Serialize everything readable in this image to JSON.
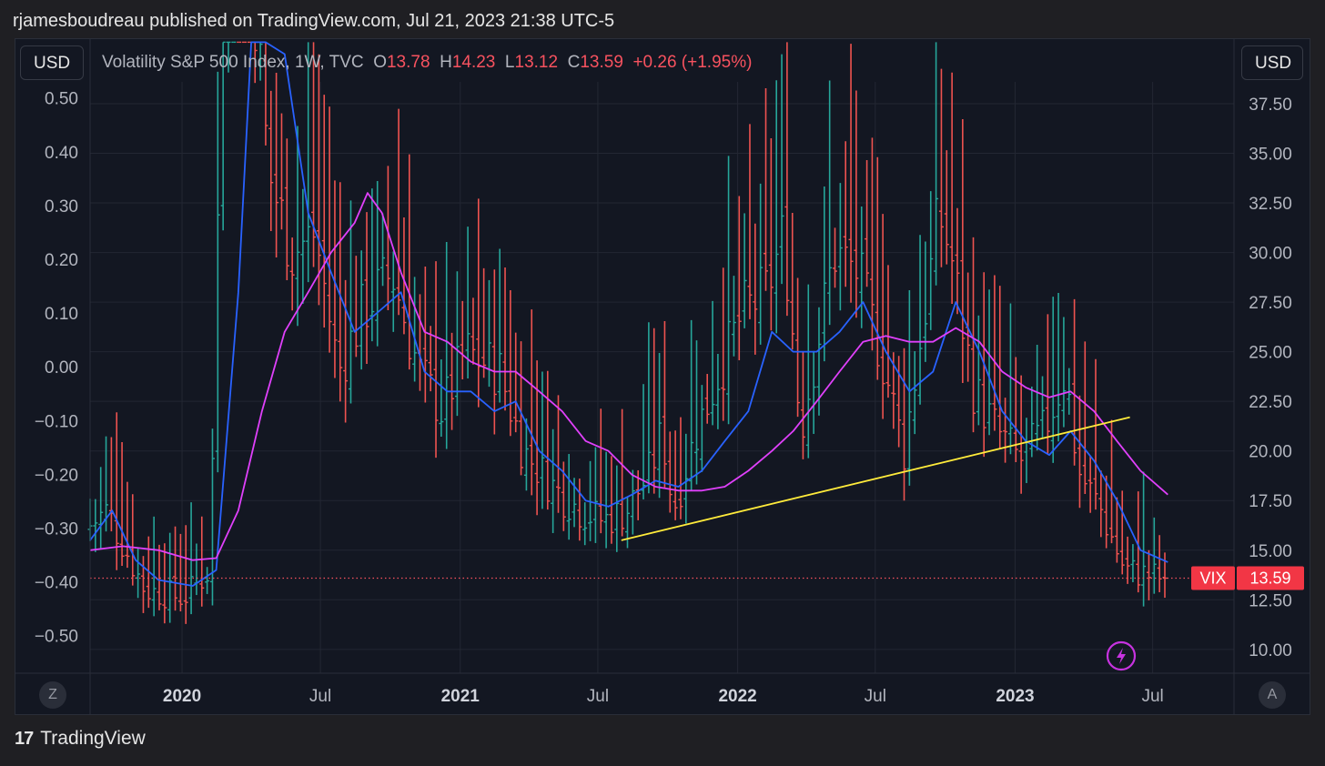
{
  "header": {
    "published_by": "rjamesboudreau published on TradingView.com, Jul 21, 2023 21:38 UTC-5"
  },
  "currency": {
    "left": "USD",
    "right": "USD"
  },
  "legend": {
    "symbol": "Volatility S&P 500 Index, 1W, TVC",
    "o_label": "O",
    "o_value": "13.78",
    "h_label": "H",
    "h_value": "14.23",
    "l_label": "L",
    "l_value": "13.12",
    "c_label": "C",
    "c_value": "13.59",
    "change": "+0.26 (+1.95%)"
  },
  "axis_buttons": {
    "left": "Z",
    "right": "A"
  },
  "price_tag": {
    "label": "VIX",
    "value": "13.59"
  },
  "footer": {
    "brand": "TradingView",
    "logo": "17"
  },
  "chart_data": {
    "type": "ohlc",
    "interval": "1W",
    "x_ticks": [
      {
        "label": "2020",
        "date": "2020-01-01",
        "bold": true
      },
      {
        "label": "Jul",
        "date": "2020-07-01",
        "bold": false
      },
      {
        "label": "2021",
        "date": "2021-01-01",
        "bold": true
      },
      {
        "label": "Jul",
        "date": "2021-07-01",
        "bold": false
      },
      {
        "label": "2022",
        "date": "2022-01-01",
        "bold": true
      },
      {
        "label": "Jul",
        "date": "2022-07-01",
        "bold": false
      },
      {
        "label": "2023",
        "date": "2023-01-01",
        "bold": true
      },
      {
        "label": "Jul",
        "date": "2023-07-01",
        "bold": false
      }
    ],
    "right_axis": {
      "ylim": [
        8.8,
        38.6
      ],
      "ticks": [
        "37.50",
        "35.00",
        "32.50",
        "30.00",
        "27.50",
        "25.00",
        "22.50",
        "20.00",
        "17.50",
        "15.00",
        "12.50",
        "10.00"
      ]
    },
    "left_axis": {
      "ylim": [
        -0.57,
        0.53
      ],
      "ticks": [
        "0.50",
        "0.40",
        "0.30",
        "0.20",
        "0.10",
        "0.00",
        "−0.10",
        "−0.20",
        "−0.30",
        "−0.40",
        "−0.50"
      ]
    },
    "series": [
      {
        "name": "VIX",
        "type": "ohlc_weekly",
        "start_date": "2019-09-02",
        "up_color": "#26a69a",
        "down_color": "#ef5350",
        "close_anchors": [
          [
            "2019-09-02",
            16
          ],
          [
            "2019-10-01",
            17
          ],
          [
            "2019-11-20",
            13
          ],
          [
            "2020-01-10",
            12.6
          ],
          [
            "2020-02-14",
            14
          ],
          [
            "2020-03-16",
            70
          ],
          [
            "2020-03-23",
            66
          ],
          [
            "2020-04-01",
            48
          ],
          [
            "2020-05-01",
            34
          ],
          [
            "2020-06-01",
            30
          ],
          [
            "2020-07-01",
            31
          ],
          [
            "2020-08-01",
            24
          ],
          [
            "2020-09-01",
            27
          ],
          [
            "2020-10-10",
            29
          ],
          [
            "2020-11-15",
            24
          ],
          [
            "2020-12-15",
            22
          ],
          [
            "2021-01-15",
            25
          ],
          [
            "2021-03-01",
            24
          ],
          [
            "2021-04-01",
            20
          ],
          [
            "2021-05-15",
            18
          ],
          [
            "2021-06-15",
            17
          ],
          [
            "2021-07-15",
            16.5
          ],
          [
            "2021-08-15",
            17
          ],
          [
            "2021-09-15",
            19
          ],
          [
            "2021-10-01",
            21
          ],
          [
            "2021-10-15",
            17
          ],
          [
            "2021-11-15",
            21
          ],
          [
            "2021-12-15",
            24
          ],
          [
            "2022-01-15",
            27
          ],
          [
            "2022-02-15",
            28
          ],
          [
            "2022-03-10",
            31
          ],
          [
            "2022-04-01",
            21
          ],
          [
            "2022-05-15",
            30
          ],
          [
            "2022-06-15",
            29
          ],
          [
            "2022-07-15",
            25
          ],
          [
            "2022-08-15",
            20
          ],
          [
            "2022-09-30",
            32
          ],
          [
            "2022-10-15",
            30
          ],
          [
            "2022-11-15",
            23
          ],
          [
            "2022-12-15",
            21
          ],
          [
            "2023-01-15",
            19.5
          ],
          [
            "2023-02-15",
            21
          ],
          [
            "2023-03-15",
            24
          ],
          [
            "2023-04-01",
            19
          ],
          [
            "2023-05-01",
            17
          ],
          [
            "2023-06-01",
            14
          ],
          [
            "2023-07-21",
            13.59
          ]
        ]
      },
      {
        "name": "MA-fast",
        "color": "#2962ff",
        "role": "moving-average",
        "points": [
          [
            "2019-09-02",
            15.5
          ],
          [
            "2019-10-01",
            17
          ],
          [
            "2019-11-01",
            14.5
          ],
          [
            "2019-12-01",
            13.5
          ],
          [
            "2020-01-15",
            13.2
          ],
          [
            "2020-02-15",
            14
          ],
          [
            "2020-03-15",
            28
          ],
          [
            "2020-04-01",
            45
          ],
          [
            "2020-04-20",
            52
          ],
          [
            "2020-05-15",
            40
          ],
          [
            "2020-06-15",
            32
          ],
          [
            "2020-07-15",
            29
          ],
          [
            "2020-08-15",
            26
          ],
          [
            "2020-09-15",
            27
          ],
          [
            "2020-10-15",
            28
          ],
          [
            "2020-11-15",
            24
          ],
          [
            "2020-12-15",
            23
          ],
          [
            "2021-01-15",
            23
          ],
          [
            "2021-02-15",
            22
          ],
          [
            "2021-03-15",
            22.5
          ],
          [
            "2021-04-15",
            20
          ],
          [
            "2021-05-15",
            19
          ],
          [
            "2021-06-15",
            17.5
          ],
          [
            "2021-07-15",
            17.2
          ],
          [
            "2021-08-15",
            17.8
          ],
          [
            "2021-09-15",
            18.5
          ],
          [
            "2021-10-15",
            18.2
          ],
          [
            "2021-11-15",
            19
          ],
          [
            "2021-12-15",
            20.5
          ],
          [
            "2022-01-15",
            22
          ],
          [
            "2022-02-15",
            26
          ],
          [
            "2022-03-15",
            25
          ],
          [
            "2022-04-15",
            25
          ],
          [
            "2022-05-15",
            26
          ],
          [
            "2022-06-15",
            27.5
          ],
          [
            "2022-07-15",
            25
          ],
          [
            "2022-08-15",
            23
          ],
          [
            "2022-09-15",
            24
          ],
          [
            "2022-10-15",
            27.5
          ],
          [
            "2022-11-15",
            25
          ],
          [
            "2022-12-15",
            22
          ],
          [
            "2023-01-15",
            20.5
          ],
          [
            "2023-02-15",
            19.8
          ],
          [
            "2023-03-15",
            21
          ],
          [
            "2023-04-15",
            19.5
          ],
          [
            "2023-05-15",
            17.5
          ],
          [
            "2023-06-15",
            15
          ],
          [
            "2023-07-21",
            14.4
          ]
        ]
      },
      {
        "name": "MA-slow",
        "color": "#e040fb",
        "role": "moving-average",
        "points": [
          [
            "2019-09-02",
            15
          ],
          [
            "2019-10-15",
            15.2
          ],
          [
            "2019-12-01",
            15
          ],
          [
            "2020-01-15",
            14.5
          ],
          [
            "2020-02-15",
            14.6
          ],
          [
            "2020-03-15",
            17
          ],
          [
            "2020-04-15",
            22
          ],
          [
            "2020-05-15",
            26
          ],
          [
            "2020-06-15",
            28
          ],
          [
            "2020-07-15",
            30
          ],
          [
            "2020-08-15",
            31.5
          ],
          [
            "2020-09-01",
            33
          ],
          [
            "2020-09-20",
            32
          ],
          [
            "2020-10-15",
            29
          ],
          [
            "2020-11-15",
            26
          ],
          [
            "2020-12-15",
            25.5
          ],
          [
            "2021-01-15",
            24.5
          ],
          [
            "2021-02-15",
            24
          ],
          [
            "2021-03-15",
            24
          ],
          [
            "2021-04-15",
            23
          ],
          [
            "2021-05-15",
            22
          ],
          [
            "2021-06-15",
            20.5
          ],
          [
            "2021-07-15",
            20
          ],
          [
            "2021-08-15",
            18.8
          ],
          [
            "2021-09-15",
            18.2
          ],
          [
            "2021-10-15",
            18
          ],
          [
            "2021-11-15",
            18
          ],
          [
            "2021-12-15",
            18.2
          ],
          [
            "2022-01-15",
            19
          ],
          [
            "2022-02-15",
            20
          ],
          [
            "2022-03-15",
            21
          ],
          [
            "2022-04-15",
            22.5
          ],
          [
            "2022-05-15",
            24
          ],
          [
            "2022-06-15",
            25.5
          ],
          [
            "2022-07-15",
            25.8
          ],
          [
            "2022-08-15",
            25.5
          ],
          [
            "2022-09-15",
            25.5
          ],
          [
            "2022-10-15",
            26.2
          ],
          [
            "2022-11-15",
            25.5
          ],
          [
            "2022-12-15",
            24
          ],
          [
            "2023-01-15",
            23.2
          ],
          [
            "2023-02-15",
            22.7
          ],
          [
            "2023-03-15",
            23
          ],
          [
            "2023-04-15",
            22
          ],
          [
            "2023-05-15",
            20.5
          ],
          [
            "2023-06-15",
            19
          ],
          [
            "2023-07-21",
            17.8
          ]
        ]
      },
      {
        "name": "Trendline",
        "color": "#ffeb3b",
        "role": "drawing",
        "points": [
          [
            "2021-08-01",
            15.5
          ],
          [
            "2023-06-01",
            21.7
          ]
        ]
      }
    ],
    "last_price": 13.59,
    "grid": true
  }
}
